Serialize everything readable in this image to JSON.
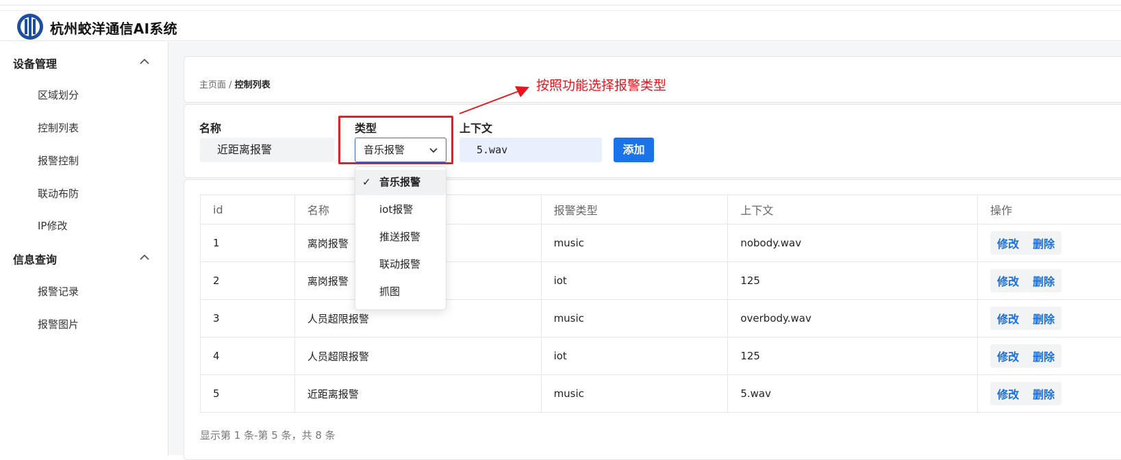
{
  "app": {
    "title": "杭州蛟洋通信AI系统"
  },
  "sidebar": {
    "groups": [
      {
        "label": "设备管理",
        "items": [
          "区域划分",
          "控制列表",
          "报警控制",
          "联动布防",
          "IP修改"
        ]
      },
      {
        "label": "信息查询",
        "items": [
          "报警记录",
          "报警图片"
        ]
      }
    ]
  },
  "breadcrumb": {
    "home": "主页面",
    "sep": "/",
    "current": "控制列表"
  },
  "annotation": {
    "text": "按照功能选择报警类型",
    "color": "#e8141c"
  },
  "form": {
    "name_label": "名称",
    "name_value": "近距离报警",
    "type_label": "类型",
    "type_value": "音乐报警",
    "context_label": "上下文",
    "context_value": "5.wav",
    "add_button": "添加"
  },
  "dropdown": {
    "options": [
      "音乐报警",
      "iot报警",
      "推送报警",
      "联动报警",
      "抓图"
    ],
    "selected": "音乐报警"
  },
  "table": {
    "columns": [
      "id",
      "名称",
      "报警类型",
      "上下文",
      "操作"
    ],
    "rows": [
      {
        "id": "1",
        "name": "离岗报警",
        "type": "music",
        "context": "nobody.wav"
      },
      {
        "id": "2",
        "name": "离岗报警",
        "type": "iot",
        "context": "125"
      },
      {
        "id": "3",
        "name": "人员超限报警",
        "type": "music",
        "context": "overbody.wav"
      },
      {
        "id": "4",
        "name": "人员超限报警",
        "type": "iot",
        "context": "125"
      },
      {
        "id": "5",
        "name": "近距离报警",
        "type": "music",
        "context": "5.wav"
      }
    ],
    "actions": {
      "edit": "修改",
      "delete": "删除"
    }
  },
  "pagination": {
    "summary": "显示第 1 条-第 5 条，共 8 条"
  },
  "colors": {
    "primary": "#1a73e8",
    "highlight_box": "#ea1b22",
    "context_input_bg": "#e9f0fd",
    "name_input_bg": "#f2f3f5"
  }
}
